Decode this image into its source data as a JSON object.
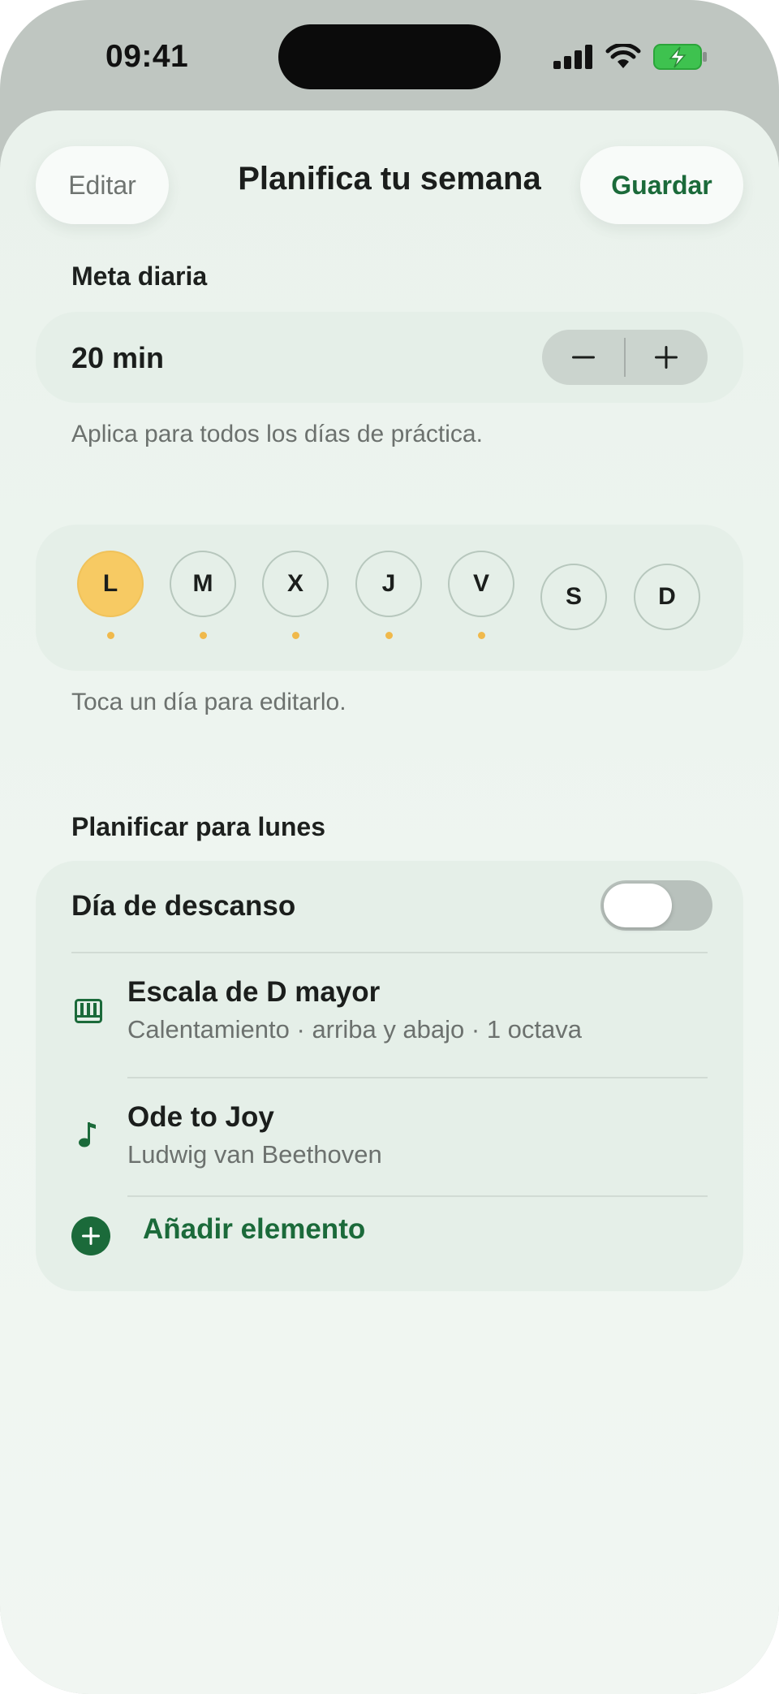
{
  "status_bar": {
    "time": "09:41"
  },
  "header": {
    "edit_label": "Editar",
    "title": "Planifica tu semana",
    "save_label": "Guardar"
  },
  "daily_goal": {
    "label": "Meta diaria",
    "value": "20 min",
    "decrement_symbol": "−",
    "increment_symbol": "+",
    "hint": "Aplica para todos los días de práctica."
  },
  "week": {
    "days": [
      {
        "letter": "L",
        "selected": true,
        "has_plan": true
      },
      {
        "letter": "M",
        "selected": false,
        "has_plan": true
      },
      {
        "letter": "X",
        "selected": false,
        "has_plan": true
      },
      {
        "letter": "J",
        "selected": false,
        "has_plan": true
      },
      {
        "letter": "V",
        "selected": false,
        "has_plan": true
      },
      {
        "letter": "S",
        "selected": false,
        "has_plan": false
      },
      {
        "letter": "D",
        "selected": false,
        "has_plan": false
      }
    ],
    "hint": "Toca un día para editarlo."
  },
  "plan": {
    "label": "Planificar para lunes",
    "rest_day_label": "Día de descanso",
    "rest_day_on": false,
    "items": [
      {
        "icon": "piano-keys-icon",
        "title": "Escala de D mayor",
        "subtitle": "Calentamiento · arriba y abajo · 1 octava"
      },
      {
        "icon": "music-note-icon",
        "title": "Ode to Joy",
        "subtitle": "Ludwig van Beethoven"
      }
    ],
    "add_label": "Añadir elemento"
  },
  "colors": {
    "accent_green": "#1b6a3a",
    "selected_day": "#f7ca63",
    "plan_dot": "#f0b94b"
  }
}
